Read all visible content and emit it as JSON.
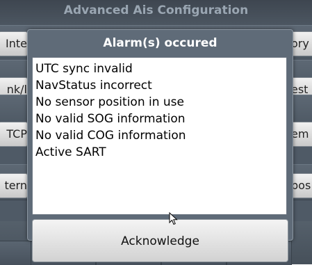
{
  "background": {
    "title": "Advanced Ais Configuration",
    "left_buttons": [
      "Inte",
      "nk/l",
      "TCP",
      "tern"
    ],
    "right_buttons": [
      "ory",
      "est",
      "em",
      "pos"
    ]
  },
  "dialog": {
    "title": "Alarm(s) occured",
    "alarms": [
      "UTC sync invalid",
      "NavStatus incorrect",
      "No sensor position in use",
      "No valid SOG information",
      "No valid COG information",
      "Active SART"
    ],
    "acknowledge_label": "Acknowledge"
  },
  "colors": {
    "dialog_bg": "#5f6b78",
    "screen_bg": "#4f5a66"
  }
}
